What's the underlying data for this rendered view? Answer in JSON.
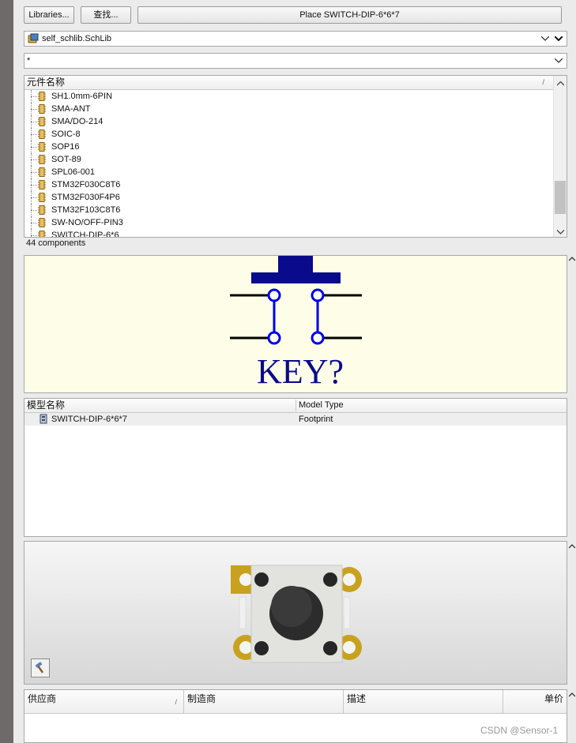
{
  "toolbar": {
    "libraries_label": "Libraries...",
    "search_label": "查找...",
    "place_label": "Place SWITCH-DIP-6*6*7"
  },
  "library_selector": {
    "value": "self_schlib.SchLib"
  },
  "filter": {
    "value": "*"
  },
  "component_list": {
    "header": "元件名称",
    "sort_indicator": "/",
    "items": [
      "SH1.0mm-6PIN",
      "SMA-ANT",
      "SMA/DO-214",
      "SOIC-8",
      "SOP16",
      "SOT-89",
      "SPL06-001",
      "STM32F030C8T6",
      "STM32F030F4P6",
      "STM32F103C8T6",
      "SW-NO/OFF-PIN3",
      "SWITCH-DIP-6*6"
    ],
    "count_text": "44 components"
  },
  "schematic_preview": {
    "designator": "KEY?"
  },
  "model_list": {
    "col_name": "模型名称",
    "col_type": "Model Type",
    "rows": [
      {
        "name": "SWITCH-DIP-6*6*7",
        "type": "Footprint"
      }
    ]
  },
  "supplier_table": {
    "col_supplier": "供应商",
    "col_manufacturer": "制造商",
    "col_description": "描述",
    "col_unit_price": "单价"
  },
  "watermark": "CSDN @Sensor-1",
  "colors": {
    "accent_navy": "#0a0a8c",
    "pin_blue": "#0000e6",
    "pad_gold": "#c8a21f",
    "preview_bg": "#fefee8"
  }
}
